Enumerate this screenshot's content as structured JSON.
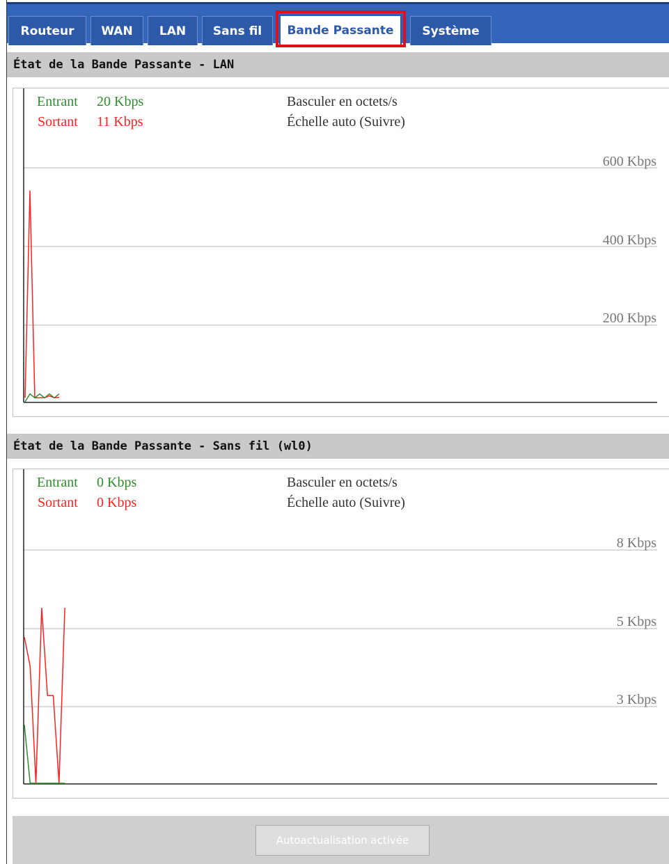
{
  "tabs": [
    {
      "label": "Routeur",
      "active": false
    },
    {
      "label": "WAN",
      "active": false
    },
    {
      "label": "LAN",
      "active": false
    },
    {
      "label": "Sans fil",
      "active": false
    },
    {
      "label": "Bande Passante",
      "active": true
    },
    {
      "label": "Système",
      "active": false
    }
  ],
  "colors": {
    "tab_bar": "#3366bb",
    "in": "#2e8b2e",
    "out": "#ff2020",
    "highlight": "#e0101b",
    "grid_label": "#777777"
  },
  "graphs": [
    {
      "title": "État de la Bande Passante - LAN",
      "in_label": "Entrant",
      "in_value": "20 Kbps",
      "out_label": "Sortant",
      "out_value": "11 Kbps",
      "toggle_link": "Basculer en octets/s",
      "scale_link": "Échelle auto (Suivre)",
      "grid_labels": [
        "600 Kbps",
        "400 Kbps",
        "200 Kbps"
      ]
    },
    {
      "title": "État de la Bande Passante - Sans fil (wl0)",
      "in_label": "Entrant",
      "in_value": "0 Kbps",
      "out_label": "Sortant",
      "out_value": "0 Kbps",
      "toggle_link": "Basculer en octets/s",
      "scale_link": "Échelle auto (Suivre)",
      "grid_labels": [
        "8 Kbps",
        "5 Kbps",
        "3 Kbps"
      ]
    }
  ],
  "chart_data": [
    {
      "type": "line",
      "ylim": [
        0,
        700
      ],
      "series": [
        {
          "name": "Entrant",
          "values": [
            0,
            20,
            10,
            20,
            10,
            20,
            10,
            20
          ]
        },
        {
          "name": "Sortant",
          "values": [
            10,
            540,
            10,
            10,
            10,
            15,
            10,
            11
          ]
        }
      ]
    },
    {
      "type": "line",
      "ylim": [
        0,
        10
      ],
      "series": [
        {
          "name": "Entrant",
          "values": [
            2,
            0,
            0,
            0,
            0,
            0,
            0,
            0
          ]
        },
        {
          "name": "Sortant",
          "values": [
            5,
            4,
            0,
            6,
            3,
            3,
            0,
            6
          ]
        }
      ]
    }
  ],
  "footer": {
    "button_label": "Autoactualisation activée"
  }
}
